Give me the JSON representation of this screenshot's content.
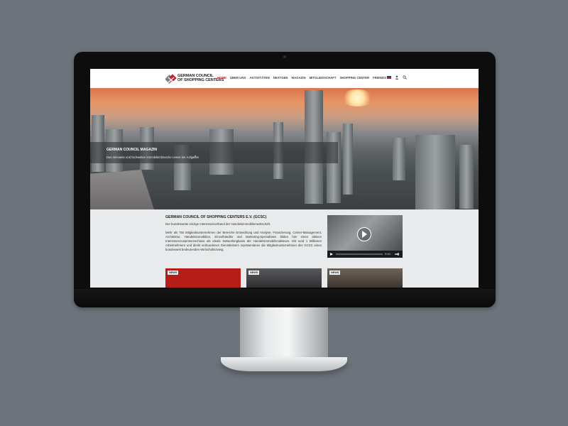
{
  "site": {
    "logo_line1": "GERMAN COUNCIL",
    "logo_line2": "OF SHOPPING CENTERS",
    "nav": [
      {
        "label": "HOME",
        "active": true
      },
      {
        "label": "ÜBER UNS",
        "active": false
      },
      {
        "label": "AKTIVITÄTEN",
        "active": false
      },
      {
        "label": "NEXTGEN",
        "active": false
      },
      {
        "label": "MAGAZIN",
        "active": false
      },
      {
        "label": "MITGLIEDSCHAFT",
        "active": false
      },
      {
        "label": "SHOPPING CENTER",
        "active": false
      },
      {
        "label": "FRIENDS",
        "active": false
      }
    ],
    "utility": {
      "language": "EN",
      "user_icon": "user-icon",
      "search_icon": "search-icon"
    }
  },
  "hero": {
    "title": "GERMAN COUNCIL MAGAZIN",
    "subtitle": "Das relevante und fachwelten Immobilienbranche Lesen Sie Aufgaben",
    "arrow_icon": "chevron-right-icon"
  },
  "intro": {
    "title": "GERMAN COUNCIL OF SHOPPING CENTERS E.V. (GCSC)",
    "subtitle": "Der bundesweite einzige Interessenverband der Handelsimmobilienwirtschaft.",
    "body": "Mehr als 750 Mitgliedsunternehmen der Bereiche Entwicklung und Analyse, Finanzierung, Center-Management, Architektur, Handelsimmobilien, Einzelhändler und Marketing-Spezialisten bilden hier einen aktiven Interessenzusammenschluss als ideale Networkingbasis der Handelsimmobilienakteure. Mit rund 1 Millionen Arbeitnehmern und direkt verbundenen Dienstleistern repräsentieren die Mitgliedsunternehmen des GCSC einen bundesweit bedeutenden Wirtschaftszweig."
  },
  "video": {
    "time": "0:00",
    "play_icon": "play-icon",
    "volume_icon": "volume-icon"
  },
  "news_cards": [
    {
      "badge": "NEWS"
    },
    {
      "badge": "NEWS"
    },
    {
      "badge": "NEWS"
    }
  ],
  "colors": {
    "accent": "#c3212b",
    "background": "#6c737a",
    "content_bg": "#e8eaeb"
  }
}
